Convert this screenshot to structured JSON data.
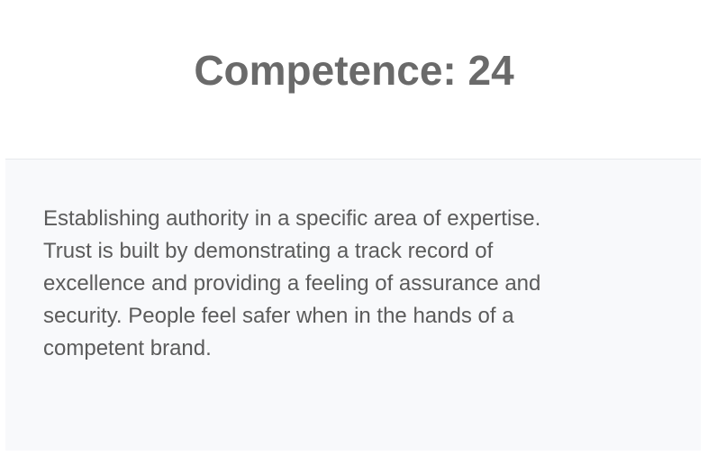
{
  "card": {
    "title": "Competence: 24",
    "description": "Establishing authority in a specific area of expertise.\nTrust is built by demonstrating a track record of\nexcellence and providing a feeling of assurance and\nsecurity. People feel safer when in the hands of a\ncompetent brand."
  },
  "colors": {
    "title_text": "#6a6a6a",
    "body_text": "#5b5b5b",
    "panel_background": "#f8f9fb",
    "divider": "#e6e9ec"
  }
}
